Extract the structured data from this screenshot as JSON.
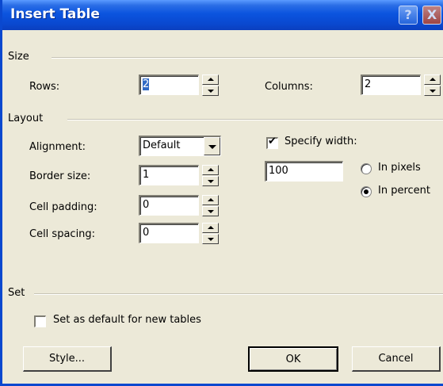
{
  "window": {
    "title": "Insert Table",
    "help": "?",
    "close": "X"
  },
  "size": {
    "legend": "Size",
    "rows_label": "Rows:",
    "rows_value": "2",
    "columns_label": "Columns:",
    "columns_value": "2"
  },
  "layout": {
    "legend": "Layout",
    "alignment_label": "Alignment:",
    "alignment_value": "Default",
    "border_label": "Border size:",
    "border_value": "1",
    "padding_label": "Cell padding:",
    "padding_value": "0",
    "spacing_label": "Cell spacing:",
    "spacing_value": "0",
    "specify_width_label": "Specify width:",
    "specify_width_checked": true,
    "width_value": "100",
    "in_pixels_label": "In pixels",
    "in_percent_label": "In percent",
    "unit_selected": "percent"
  },
  "set": {
    "legend": "Set",
    "default_label": "Set as default for new tables",
    "default_checked": false
  },
  "buttons": {
    "style": "Style...",
    "ok": "OK",
    "cancel": "Cancel"
  }
}
